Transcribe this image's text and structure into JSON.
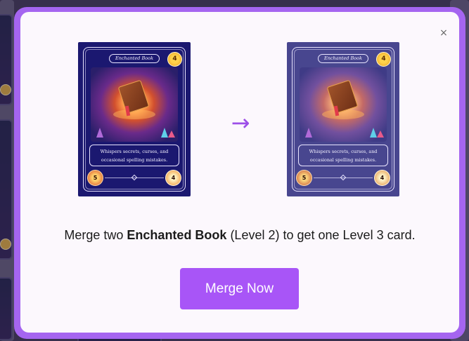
{
  "modal": {
    "close_label": "×",
    "accent_color": "#a855f7",
    "frame_color": "#a565f0"
  },
  "source_card": {
    "name": "Enchanted Book",
    "level": "4",
    "description": "Whispers secrets, curses, and occasional spelling mistakes.",
    "attack": "5",
    "health": "4"
  },
  "result_card": {
    "name": "Enchanted Book",
    "level": "4",
    "description": "Whispers secrets, curses, and occasional spelling mistakes.",
    "attack": "5",
    "health": "4"
  },
  "arrow_icon": "right-arrow-icon",
  "arrow_glyph": "→",
  "message": {
    "prefix": "Merge two ",
    "card_name": "Enchanted Book",
    "suffix": " (Level 2) to get one Level 3 card."
  },
  "merge_button": {
    "label": "Merge Now"
  }
}
